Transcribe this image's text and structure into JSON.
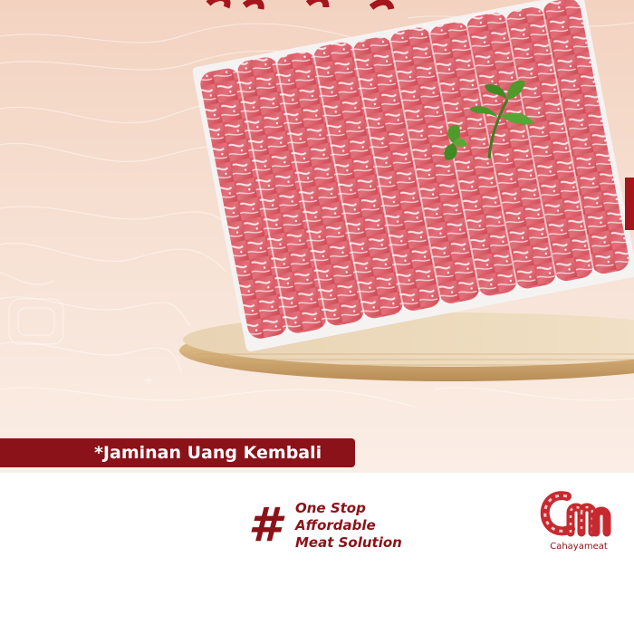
{
  "banner": {
    "guarantee_text": "*Jaminan Uang Kembali"
  },
  "tagline": {
    "hash_symbol": "#",
    "lines": [
      "One Stop",
      "Affordable",
      "Meat Solution"
    ]
  },
  "logo": {
    "monogram": "cm",
    "wordmark": "Cahayameat"
  },
  "colors": {
    "brand_red": "#8b1219",
    "peach_background": "#f3d2c0"
  },
  "icons": [
    "meat-tray-image",
    "parsley-garnish-icon",
    "wooden-board-icon",
    "cm-logo-icon"
  ]
}
